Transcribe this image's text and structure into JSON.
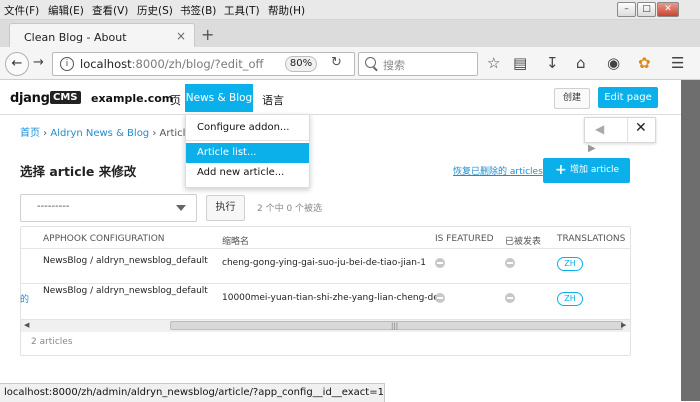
{
  "browser": {
    "menu": [
      "文件(F)",
      "编辑(E)",
      "查看(V)",
      "历史(S)",
      "书签(B)",
      "工具(T)",
      "帮助(H)"
    ],
    "window_controls": {
      "minimize": "–",
      "maximize": "□",
      "close": "✕"
    },
    "tab": {
      "title": "Clean Blog - About",
      "close": "×"
    },
    "new_tab": "+",
    "url_host": "localhost",
    "url_rest": ":8000/zh/blog/?edit_off",
    "zoom": "80%",
    "search_placeholder": "搜索",
    "status_url": "localhost:8000/zh/admin/aldryn_newsblog/article/?app_config__id__exact=1"
  },
  "cms_toolbar": {
    "logo_django": "django",
    "logo_cms": "CMS",
    "site_name": "example.com",
    "page_menu": "页",
    "newsblog_menu": "News & Blog",
    "language_menu": "语言",
    "create_button": "创建",
    "edit_page_button": "Edit page"
  },
  "dropdown": {
    "items": [
      "Configure addon...",
      "Article list...",
      "Add new article..."
    ],
    "active_index": 1
  },
  "sideframe": {
    "left_arrow": "◀",
    "close": "✕",
    "arrow": "▶"
  },
  "admin": {
    "breadcrumb": {
      "home": "首页",
      "sep1": " › ",
      "app": "Aldryn News & Blog",
      "sep2": " › ",
      "current": "Articles"
    },
    "title": "选择 article 来修改",
    "restore_link": "恢复已删除的 articles",
    "add_button": {
      "icon": "+",
      "label": "增加 article"
    },
    "action_select": "---------",
    "go_button": "执行",
    "selection_counter": "2 个中 0 个被选",
    "columns": [
      "APPHOOK CONFIGURATION",
      "缩略名",
      "IS FEATURED",
      "已被发表",
      "TRANSLATIONS"
    ],
    "rows": [
      {
        "apphook": "NewsBlog / aldryn_newsblog_default",
        "slug": "cheng-gong-ying-gai-suo-ju-bei-de-tiao-jian-1",
        "translation": "ZH"
      },
      {
        "apphook": "NewsBlog / aldryn_newsblog_default",
        "slug": "10000mei-yuan-tian-shi-zhe-yang-lian-cheng-de",
        "translation": "ZH"
      }
    ],
    "stray_link": "的",
    "scroll": {
      "left": "◀",
      "grip": "|||",
      "right": "▶"
    },
    "result_count": "2 articles"
  },
  "colors": {
    "accent": "#0bb0eb",
    "link": "#1c8fd1",
    "text": "#333333"
  }
}
